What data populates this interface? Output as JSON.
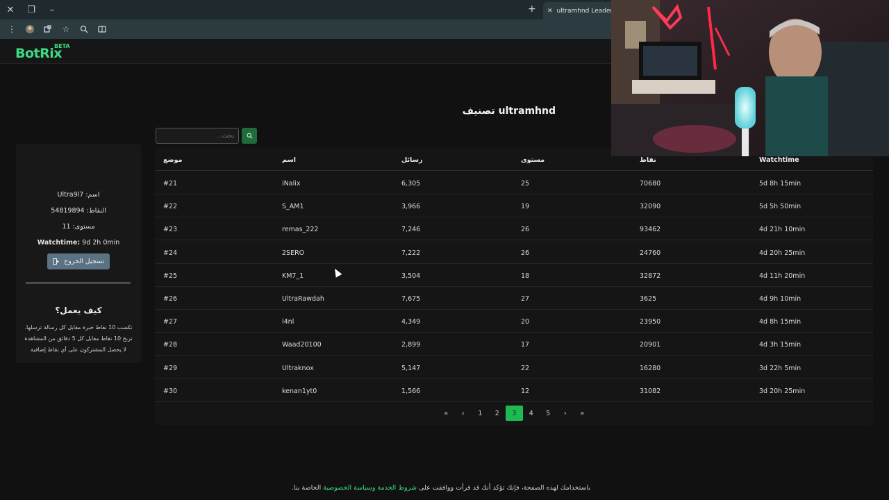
{
  "browser": {
    "tab_title": "ultramhnd LeaderBoard",
    "window_controls": {
      "close": "✕",
      "restore": "❐",
      "minimize": "–"
    },
    "new_tab": "+",
    "tab_close": "✕"
  },
  "navbar": {
    "logo": "BotRix",
    "badge": "BETA"
  },
  "page": {
    "title": "ultramhnd تصنيف"
  },
  "search": {
    "placeholder": "بحث..."
  },
  "profile": {
    "name_label": "اسم:",
    "name_value": "Ultra9l7",
    "points_label": "النقاط:",
    "points_value": "54819894",
    "level_label": "مستوى:",
    "level_value": "11",
    "watchtime_label": "Watchtime:",
    "watchtime_value": "9d 2h 0min",
    "logout_label": "تسجيل الخروج"
  },
  "how_it_works": {
    "title": "كيف يعمل؟",
    "lines": [
      "تكسب 10 نقاط خبرة مقابل كل رسالة ترسلها.",
      "تربح 10 نقاط مقابل كل 5 دقائق من المشاهدة",
      "لا يحصل المشتركون على أي نقاط إضافية"
    ]
  },
  "table": {
    "headers": {
      "position": "موضع",
      "name": "اسم",
      "messages": "رسائل",
      "level": "مستوى",
      "points": "نقاط",
      "watchtime": "Watchtime"
    },
    "rows": [
      {
        "position": "#21",
        "name": "iNalix",
        "messages": "6,305",
        "level": "25",
        "points": "70680",
        "watchtime": "5d 8h 15min"
      },
      {
        "position": "#22",
        "name": "S_AM1",
        "messages": "3,966",
        "level": "19",
        "points": "32090",
        "watchtime": "5d 5h 50min"
      },
      {
        "position": "#23",
        "name": "remas_222",
        "messages": "7,246",
        "level": "26",
        "points": "93462",
        "watchtime": "4d 21h 10min"
      },
      {
        "position": "#24",
        "name": "2SERO",
        "messages": "7,222",
        "level": "26",
        "points": "24760",
        "watchtime": "4d 20h 25min"
      },
      {
        "position": "#25",
        "name": "KM7_1",
        "messages": "3,504",
        "level": "18",
        "points": "32872",
        "watchtime": "4d 11h 20min"
      },
      {
        "position": "#26",
        "name": "UltraRawdah",
        "messages": "7,675",
        "level": "27",
        "points": "3625",
        "watchtime": "4d 9h 10min"
      },
      {
        "position": "#27",
        "name": "i4nl",
        "messages": "4,349",
        "level": "20",
        "points": "23950",
        "watchtime": "4d 8h 15min"
      },
      {
        "position": "#28",
        "name": "Waad20100",
        "messages": "2,899",
        "level": "17",
        "points": "20901",
        "watchtime": "4d 3h 15min"
      },
      {
        "position": "#29",
        "name": "Ultraknox",
        "messages": "5,147",
        "level": "22",
        "points": "16280",
        "watchtime": "3d 22h 5min"
      },
      {
        "position": "#30",
        "name": "kenan1yt0",
        "messages": "1,566",
        "level": "12",
        "points": "31082",
        "watchtime": "3d 20h 25min"
      }
    ]
  },
  "pagination": {
    "first": "«",
    "prev": "‹",
    "pages": [
      "1",
      "2",
      "3",
      "4",
      "5"
    ],
    "current": "3",
    "next": "›",
    "last": "»"
  },
  "footer": {
    "prefix": "باستخدامك لهذه الصفحة، فإنك تؤكد أنك قد قرأت ووافقت على ",
    "link": "شروط الخدمة وسياسة الخصوصية",
    "suffix": " الخاصة بنا."
  },
  "colors": {
    "accent": "#3ddc84",
    "active_page": "#1fb954",
    "background": "#111111",
    "card": "#151515",
    "logout": "#5a7282"
  }
}
